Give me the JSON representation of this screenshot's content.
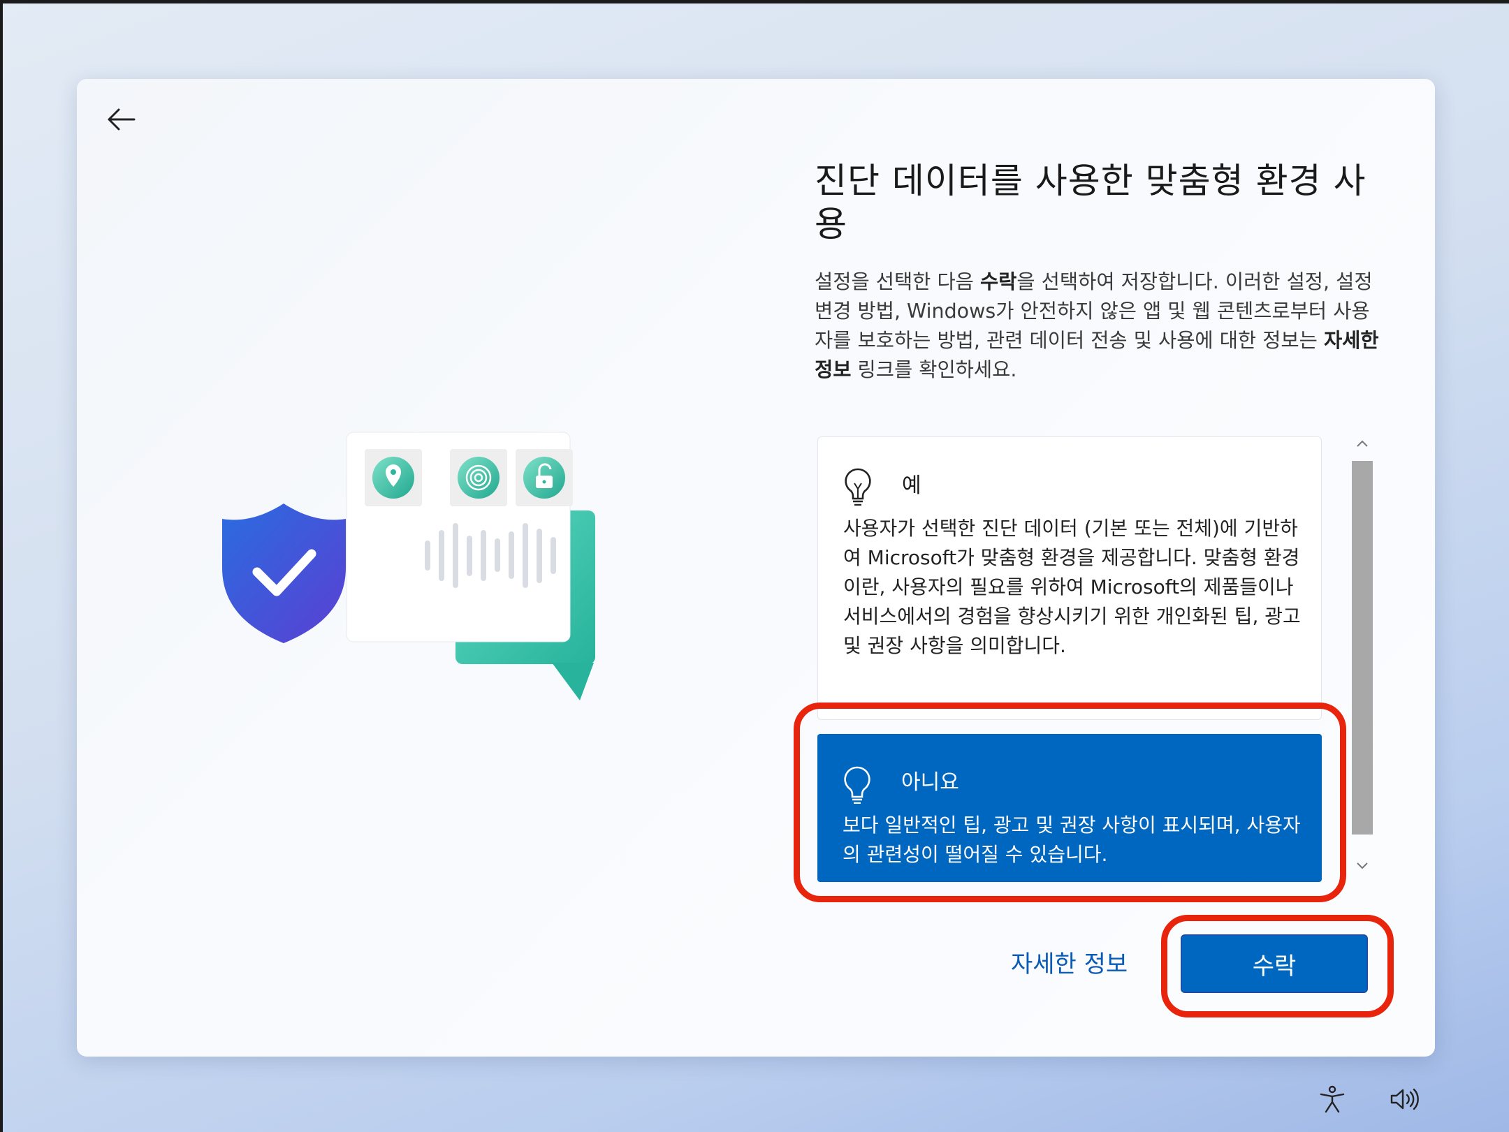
{
  "page": {
    "title": "진단 데이터를 사용한 맞춤형 환경 사용",
    "description": {
      "part1": "설정을 선택한 다음 ",
      "bold1": "수락",
      "part2": "을 선택하여 저장합니다. 이러한 설정, 설정 변경 방법, Windows가 안전하지 않은 앱 및 웹 콘텐츠로부터 사용자를 보호하는 방법, 관련 데이터 전송 및 사용에 대한 정보는 ",
      "bold2": "자세한 정보",
      "part3": " 링크를 확인하세요."
    }
  },
  "options": [
    {
      "title": "예",
      "text": "사용자가 선택한 진단 데이터 (기본 또는 전체)에 기반하여 Microsoft가 맞춤형 환경을 제공합니다. 맞춤형 환경이란, 사용자의 필요를 위하여 Microsoft의 제품들이나 서비스에서의 경험을 향상시키기 위한 개인화된 팁, 광고 및 권장 사항을 의미합니다.",
      "selected": false
    },
    {
      "title": "아니요",
      "text": "보다 일반적인 팁, 광고 및 권장 사항이 표시되며, 사용자의 관련성이 떨어질 수 있습니다.",
      "selected": true
    }
  ],
  "footer": {
    "learn_more": "자세한 정보",
    "accept": "수락"
  },
  "colors": {
    "accent": "#0067c0",
    "highlight": "#e8240c",
    "link": "#0a5bb5"
  },
  "icons": [
    "back-arrow-icon",
    "lightbulb-icon",
    "location-pin-icon",
    "fingerprint-icon",
    "unlock-icon",
    "shield-check-icon",
    "accessibility-icon",
    "volume-icon"
  ]
}
